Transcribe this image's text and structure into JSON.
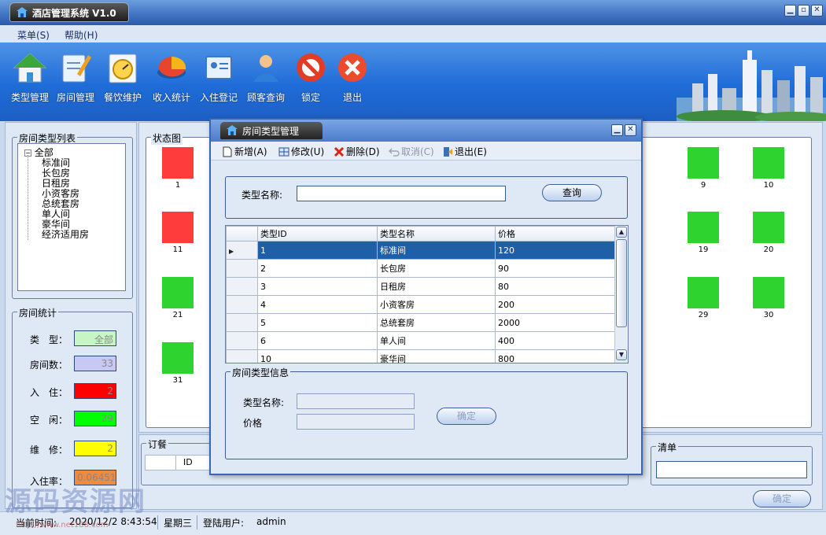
{
  "window": {
    "title": "酒店管理系统 V1.0",
    "min": "▁",
    "max": "▫",
    "close": "✕"
  },
  "menu": {
    "items": [
      "菜单(S)",
      "帮助(H)"
    ]
  },
  "toolbar": {
    "items": [
      "类型管理",
      "房间管理",
      "餐饮维护",
      "收入统计",
      "入住登记",
      "顾客查询",
      "锁定",
      "退出"
    ]
  },
  "sidebar": {
    "tree_title": "房间类型列表",
    "tree_root": "全部",
    "tree_items": [
      "标准间",
      "长包房",
      "日租房",
      "小资客房",
      "总统套房",
      "单人间",
      "豪华间",
      "经济适用房"
    ],
    "stats_title": "房间统计",
    "stats": [
      {
        "label": "类　型：",
        "value": "全部",
        "color": "#c8f5c4"
      },
      {
        "label": "房间数：",
        "value": "33",
        "color": "#c8c8f5"
      },
      {
        "label": "入　住：",
        "value": "2",
        "color": "#ff0000"
      },
      {
        "label": "空　闲：",
        "value": "29",
        "color": "#00ff00"
      },
      {
        "label": "维　修：",
        "value": "2",
        "color": "#ffff00"
      },
      {
        "label": "入住率：",
        "value": "0.06451",
        "color": "#f08a3c"
      }
    ]
  },
  "status_map": {
    "title": "状态图",
    "colors": {
      "occupied": "#ff3c3c",
      "free": "#2fd32f"
    },
    "rooms": [
      {
        "num": "1",
        "state": "occupied"
      },
      {
        "num": "9",
        "state": "free"
      },
      {
        "num": "10",
        "state": "free"
      },
      {
        "num": "11",
        "state": "occupied"
      },
      {
        "num": "19",
        "state": "free"
      },
      {
        "num": "20",
        "state": "free"
      },
      {
        "num": "21",
        "state": "free"
      },
      {
        "num": "29",
        "state": "free"
      },
      {
        "num": "30",
        "state": "free"
      },
      {
        "num": "31",
        "state": "free"
      }
    ]
  },
  "order": {
    "title": "订餐",
    "col_id": "ID",
    "list_title": "清单",
    "confirm": "确定"
  },
  "dialog": {
    "title": "房间类型管理",
    "tools": [
      "新增(A)",
      "修改(U)",
      "删除(D)",
      "取消(C)",
      "退出(E)"
    ],
    "search_label": "类型名称:",
    "search_value": "",
    "search_button": "查询",
    "columns": [
      "类型ID",
      "类型名称",
      "价格"
    ],
    "rows": [
      [
        "1",
        "标准间",
        "120"
      ],
      [
        "2",
        "长包房",
        "90"
      ],
      [
        "3",
        "日租房",
        "80"
      ],
      [
        "4",
        "小资客房",
        "200"
      ],
      [
        "5",
        "总统套房",
        "2000"
      ],
      [
        "6",
        "单人间",
        "400"
      ],
      [
        "10",
        "豪华间",
        "800"
      ]
    ],
    "info_title": "房间类型信息",
    "info_name_label": "类型名称:",
    "info_price_label": "价格",
    "info_confirm": "确定"
  },
  "status": {
    "time_label": "当前时间:",
    "time_value": "2020/12/2 8:43:54",
    "weekday": "星期三",
    "user_label": "登陆用户:",
    "user_value": "admin"
  },
  "watermark": {
    "text": "源码资源网",
    "url": "http://www.net188.com"
  }
}
